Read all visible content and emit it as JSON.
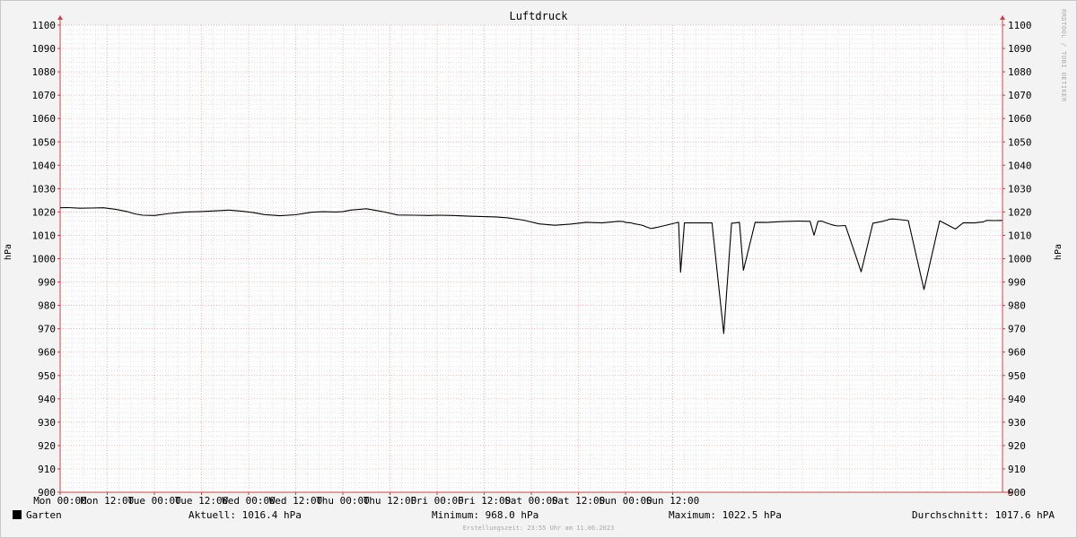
{
  "chart_data": {
    "type": "line",
    "title": "Luftdruck",
    "ylabel": "hPa",
    "ylim": [
      900,
      1100
    ],
    "ytick_step": 10,
    "grid": true,
    "x_range": [
      "Mon 00:00",
      "Sun 23:55"
    ],
    "x_tick_labels": [
      "Mon 00:00",
      "Mon 12:00",
      "Tue 00:00",
      "Tue 12:00",
      "Wed 00:00",
      "Wed 12:00",
      "Thu 00:00",
      "Thu 12:00",
      "Fri 00:00",
      "Fri 12:00",
      "Sat 00:00",
      "Sat 12:00",
      "Sun 00:00",
      "Sun 12:00"
    ],
    "series": [
      {
        "name": "Garten",
        "color": "#000000",
        "x_hours": [
          0,
          2,
          5,
          8,
          11,
          14,
          17,
          19,
          21,
          24,
          28,
          32,
          36,
          40,
          43,
          46,
          49,
          52,
          56,
          60,
          64,
          67,
          70,
          72,
          74,
          78,
          82,
          86,
          90,
          94,
          96,
          100,
          104,
          108,
          111,
          114,
          118,
          122,
          126,
          130,
          134,
          138,
          141,
          142,
          143.5,
          144,
          145.5,
          146,
          147.5,
          148.5,
          149,
          150,
          150.5,
          151,
          152,
          154,
          157,
          157.5,
          158,
          159,
          161,
          163,
          166,
          169,
          171,
          172,
          173,
          174,
          177,
          180,
          184,
          188,
          191,
          192,
          193,
          194,
          195,
          196,
          197,
          198,
          200,
          204,
          207,
          209.5,
          210,
          210.5,
          211,
          212,
          214,
          216,
          220,
          224,
          228,
          230,
          233,
          234,
          235,
          236,
          238,
          239.9
        ],
        "values": [
          1021.8,
          1021.9,
          1021.6,
          1021.7,
          1021.8,
          1021.2,
          1020.2,
          1019.2,
          1018.6,
          1018.5,
          1019.4,
          1020.0,
          1020.2,
          1020.5,
          1020.8,
          1020.4,
          1019.8,
          1018.9,
          1018.4,
          1018.8,
          1019.9,
          1020.1,
          1020.0,
          1020.1,
          1020.8,
          1021.4,
          1020.2,
          1018.7,
          1018.6,
          1018.5,
          1018.6,
          1018.5,
          1018.2,
          1018.0,
          1017.9,
          1017.5,
          1016.5,
          1014.9,
          1014.3,
          1014.8,
          1015.6,
          1015.3,
          1015.8,
          1016.0,
          1015.9,
          1015.5,
          1015.3,
          1015.0,
          1014.6,
          1014.2,
          1013.8,
          1013.2,
          1012.9,
          1013.1,
          1013.4,
          1014.2,
          1015.4,
          1015.6,
          994.2,
          1015.3,
          1015.3,
          1015.3,
          1015.3,
          968.0,
          1015.2,
          1015.3,
          1015.6,
          995.0,
          1015.6,
          1015.5,
          1015.9,
          1016.1,
          1016.0,
          1010.0,
          1016.0,
          1016.1,
          1015.4,
          1014.8,
          1014.3,
          1014.0,
          1014.2,
          994.4,
          1015.2,
          1016.0,
          1016.3,
          1016.4,
          1016.8,
          1017.0,
          1016.7,
          1016.3,
          986.8,
          1016.2,
          1012.7,
          1015.4,
          1015.3,
          1015.6,
          1015.7,
          1016.4,
          1016.3,
          1016.4
        ]
      }
    ]
  },
  "legend": {
    "series_label": "Garten",
    "current": "Aktuell: 1016.4 hPa",
    "minimum": "Minimum: 968.0 hPa",
    "maximum": "Maximum: 1022.5 hPa",
    "average": "Durchschnitt: 1017.6 hPA"
  },
  "watermark": "RRDTOOL / TOBI OETIKER",
  "footer": "Erstellungszeit: 23:55 Uhr am 11.06.2023"
}
